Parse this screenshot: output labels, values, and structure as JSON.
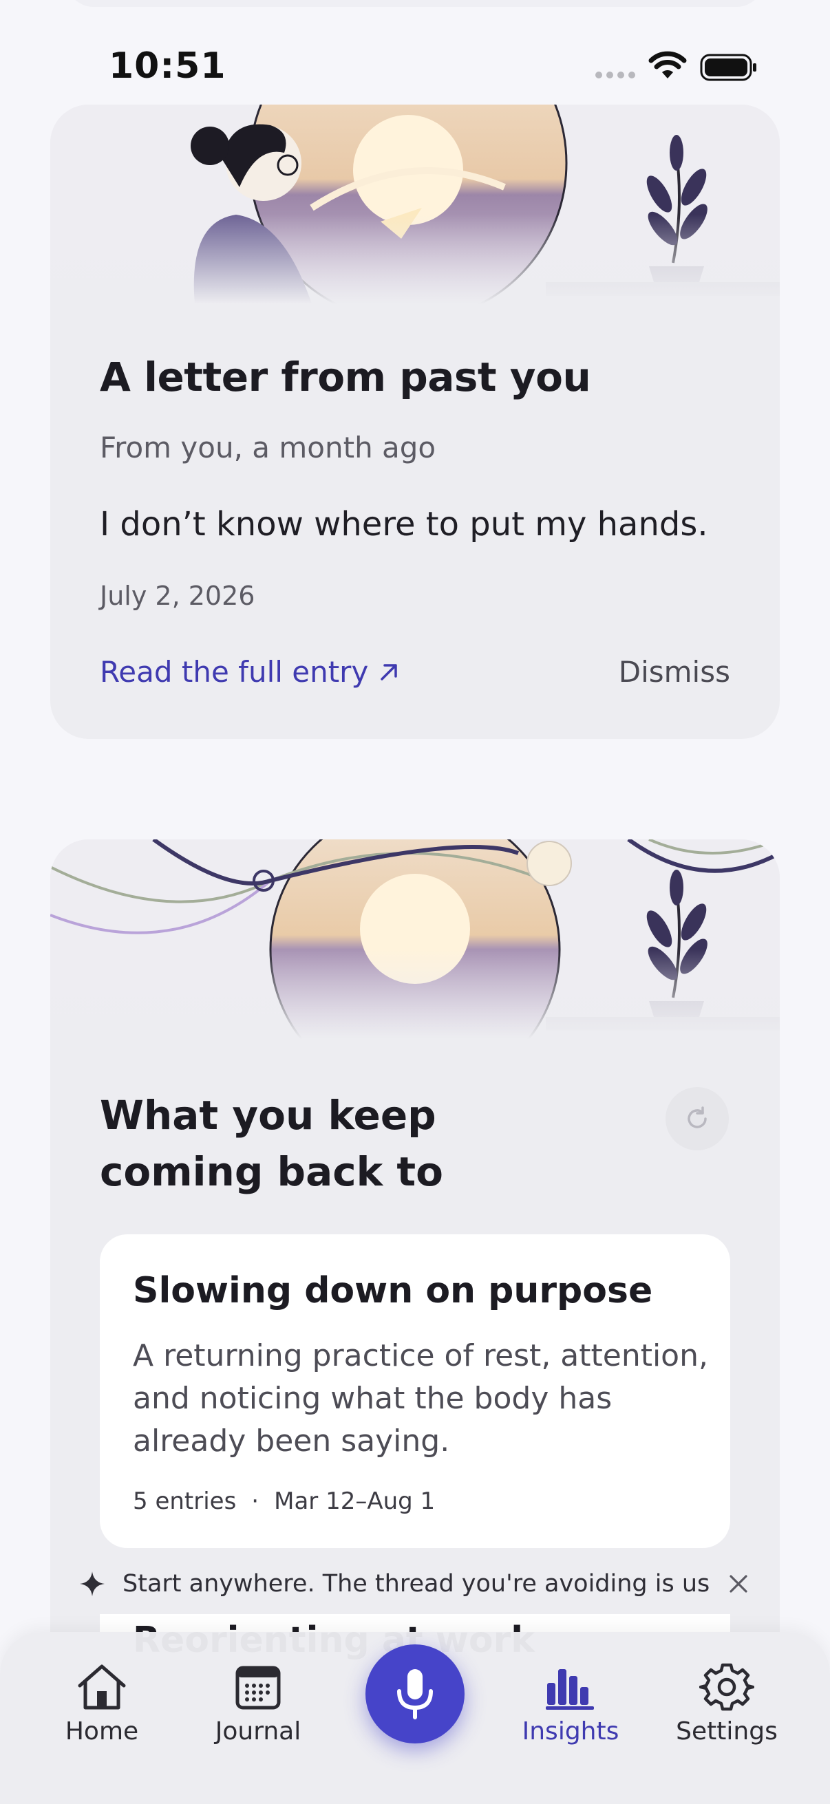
{
  "status_bar": {
    "time": "10:51"
  },
  "letter_card": {
    "title": "A letter from past you",
    "subtitle": "From you, a month ago",
    "quote": "I don’t know where to put my hands.",
    "date": "July 2, 2026",
    "read_link": "Read the full entry",
    "dismiss": "Dismiss"
  },
  "themes_card": {
    "title": "What you keep coming back to",
    "themes": [
      {
        "title": "Slowing down on purpose",
        "description": "A returning practice of rest, attention, and noticing what the body has already been saying.",
        "entries": "5 entries",
        "separator": "·",
        "range": "Mar 12–Aug 1"
      },
      {
        "title": "Reorienting at work"
      }
    ]
  },
  "tip": {
    "text": "Start anywhere. The thread you're avoiding is usually…"
  },
  "tabbar": {
    "items": [
      {
        "label": "Home",
        "icon": "home-icon"
      },
      {
        "label": "Journal",
        "icon": "calendar-icon"
      },
      {
        "label": "Insights",
        "icon": "bar-chart-icon",
        "active": true
      },
      {
        "label": "Settings",
        "icon": "gear-icon"
      }
    ],
    "record_icon": "microphone-icon"
  },
  "colors": {
    "accent": "#3f3ab0",
    "mic_button": "#4644c9",
    "card_bg": "#ededf1",
    "page_bg": "#f6f6fa"
  }
}
